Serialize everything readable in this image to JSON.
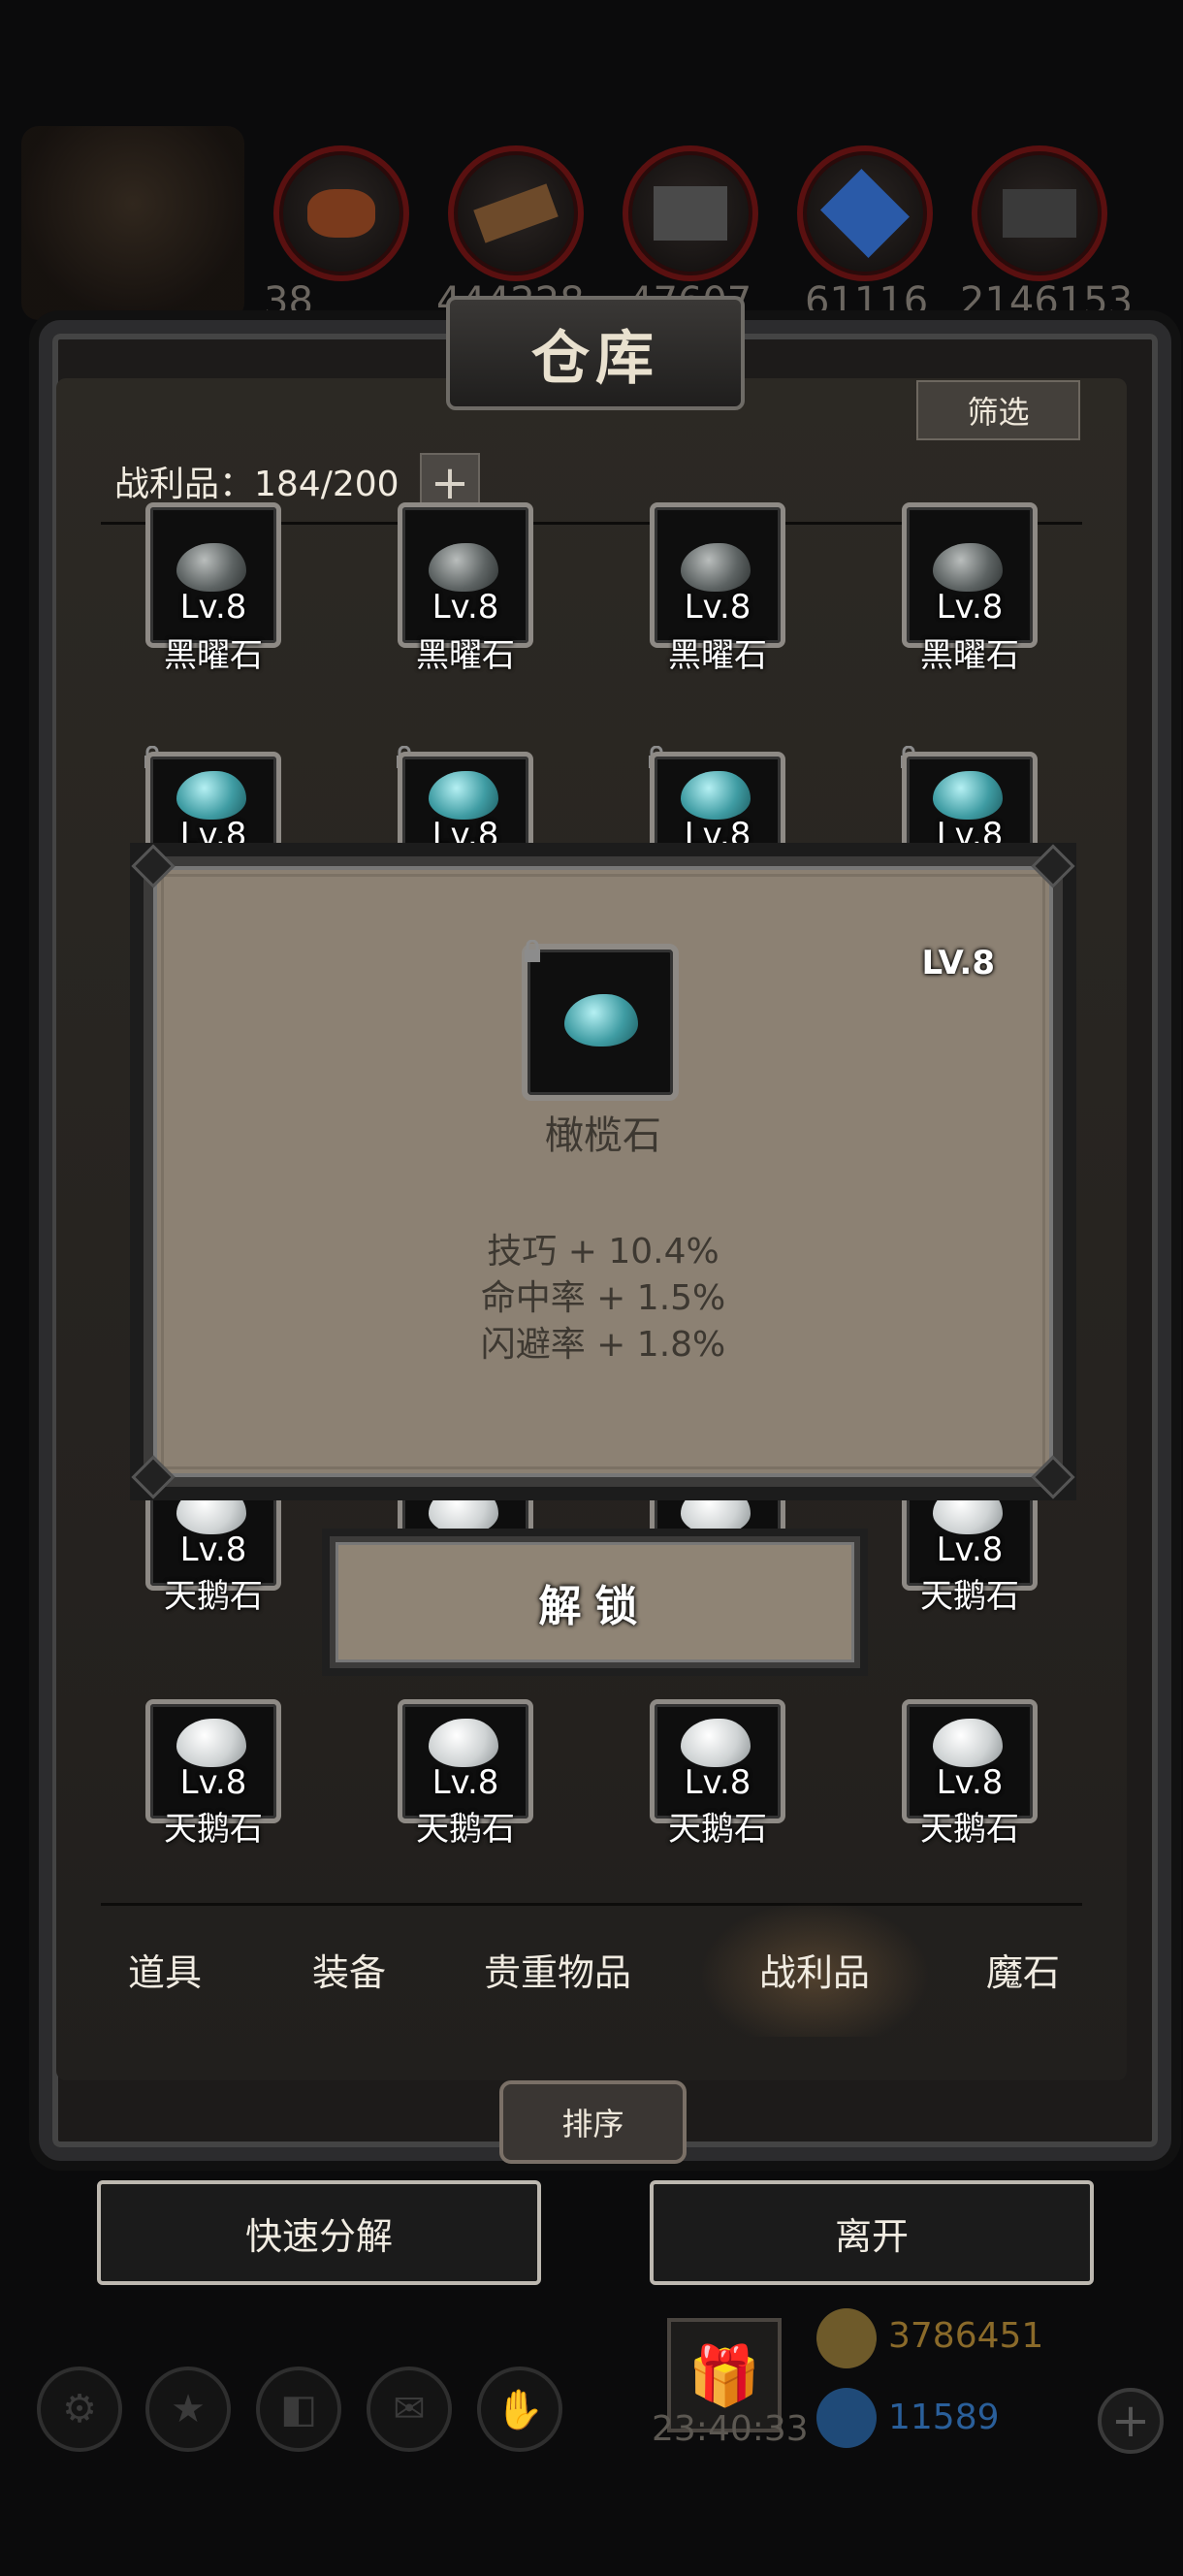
{
  "top_resources": [
    {
      "icon": "meat-icon",
      "value": "38"
    },
    {
      "icon": "wood-planks-icon",
      "value": "444228"
    },
    {
      "icon": "stone-blocks-icon",
      "value": "47607"
    },
    {
      "icon": "crystal-icon",
      "value": "61116"
    },
    {
      "icon": "iron-ingot-icon",
      "value": "2146153"
    }
  ],
  "warehouse": {
    "title": "仓库",
    "filter_label": "筛选",
    "count_label": "战利品：184/200",
    "plus_label": "+"
  },
  "items": [
    {
      "gem": "black",
      "level": "Lv.8",
      "name": "黑曜石"
    },
    {
      "gem": "black",
      "level": "Lv.8",
      "name": "黑曜石"
    },
    {
      "gem": "black",
      "level": "Lv.8",
      "name": "黑曜石"
    },
    {
      "gem": "black",
      "level": "Lv.8",
      "name": "黑曜石"
    },
    {
      "gem": "blue",
      "level": "Lv.8",
      "name": ""
    },
    {
      "gem": "blue",
      "level": "Lv.8",
      "name": ""
    },
    {
      "gem": "blue",
      "level": "Lv.8",
      "name": ""
    },
    {
      "gem": "blue",
      "level": "Lv.8",
      "name": ""
    },
    {
      "gem": "white",
      "level": "Lv.8",
      "name": "天鹅石"
    },
    {
      "gem": "white",
      "level": "",
      "name": ""
    },
    {
      "gem": "white",
      "level": "",
      "name": ""
    },
    {
      "gem": "white",
      "level": "Lv.8",
      "name": "天鹅石"
    },
    {
      "gem": "white",
      "level": "Lv.8",
      "name": "天鹅石"
    },
    {
      "gem": "white",
      "level": "Lv.8",
      "name": "天鹅石"
    },
    {
      "gem": "white",
      "level": "Lv.8",
      "name": "天鹅石"
    },
    {
      "gem": "white",
      "level": "Lv.8",
      "name": "天鹅石"
    }
  ],
  "popup": {
    "level": "LV.8",
    "name": "橄榄石",
    "stats": [
      "技巧 + 10.4%",
      "命中率 + 1.5%",
      "闪避率 + 1.8%"
    ],
    "unlock_label": "解锁"
  },
  "tabs": [
    {
      "label": "道具",
      "active": false
    },
    {
      "label": "装备",
      "active": false
    },
    {
      "label": "贵重物品",
      "active": false
    },
    {
      "label": "战利品",
      "active": true
    },
    {
      "label": "魔石",
      "active": false
    }
  ],
  "sort_label": "排序",
  "quick_decompose_label": "快速分解",
  "leave_label": "离开",
  "hud": {
    "timer": "23:40:33",
    "gold": "3786451",
    "diamond": "11589",
    "gold_color": "#8a6a2a",
    "diamond_color": "#2a5f9a"
  }
}
